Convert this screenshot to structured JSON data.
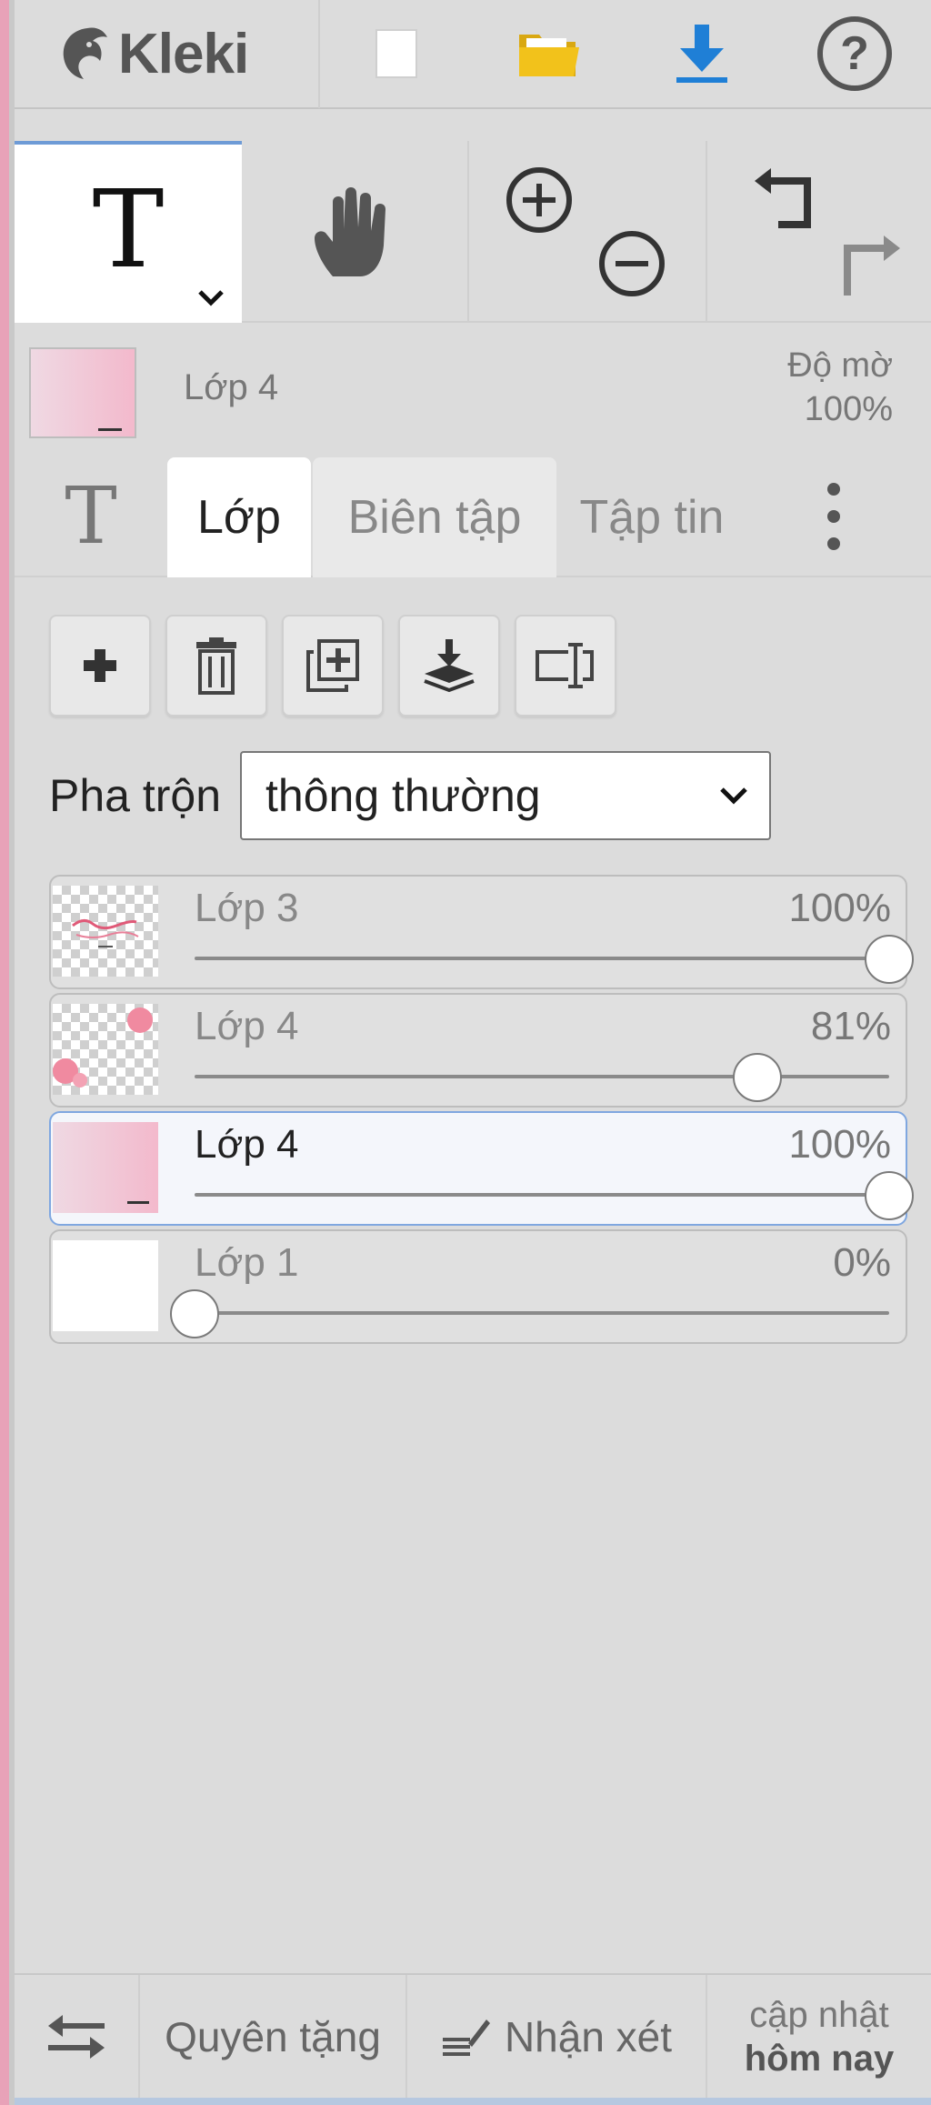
{
  "header": {
    "logo_text": "Kleki",
    "buttons": [
      "new-image",
      "open-file",
      "save-download",
      "help"
    ],
    "help_glyph": "?"
  },
  "tools": {
    "active_tool_glyph": "T",
    "items": [
      "text-tool",
      "hand-tool",
      "zoom-in",
      "zoom-out",
      "undo",
      "redo"
    ]
  },
  "current_layer": {
    "name": "Lớp 4",
    "opacity_label": "Độ mờ",
    "opacity_value": "100%"
  },
  "tabs": {
    "icon_glyph": "T",
    "items": [
      {
        "label": "Lớp",
        "active": true
      },
      {
        "label": "Biên tập",
        "active": false
      },
      {
        "label": "Tập tin",
        "active": false
      }
    ]
  },
  "layer_actions": [
    "add-layer",
    "delete-layer",
    "duplicate-layer",
    "merge-down",
    "rename-layer"
  ],
  "blend": {
    "label": "Pha trộn",
    "value": "thông thường"
  },
  "layers": [
    {
      "name": "Lớp 3",
      "opacity_text": "100%",
      "opacity": 1.0,
      "selected": false
    },
    {
      "name": "Lớp 4",
      "opacity_text": "81%",
      "opacity": 0.81,
      "selected": false
    },
    {
      "name": "Lớp 4",
      "opacity_text": "100%",
      "opacity": 1.0,
      "selected": true
    },
    {
      "name": "Lớp 1",
      "opacity_text": "0%",
      "opacity": 0.0,
      "selected": false
    }
  ],
  "footer": {
    "donate": "Quyên tặng",
    "feedback": "Nhận xét",
    "update_line1": "cập nhật",
    "update_line2": "hôm nay"
  },
  "colors": {
    "accent_blue": "#1f7fd6",
    "folder_yellow": "#f2c21b",
    "selection_border": "#7fa7e0",
    "canvas_pink": "#f3b9cc"
  }
}
